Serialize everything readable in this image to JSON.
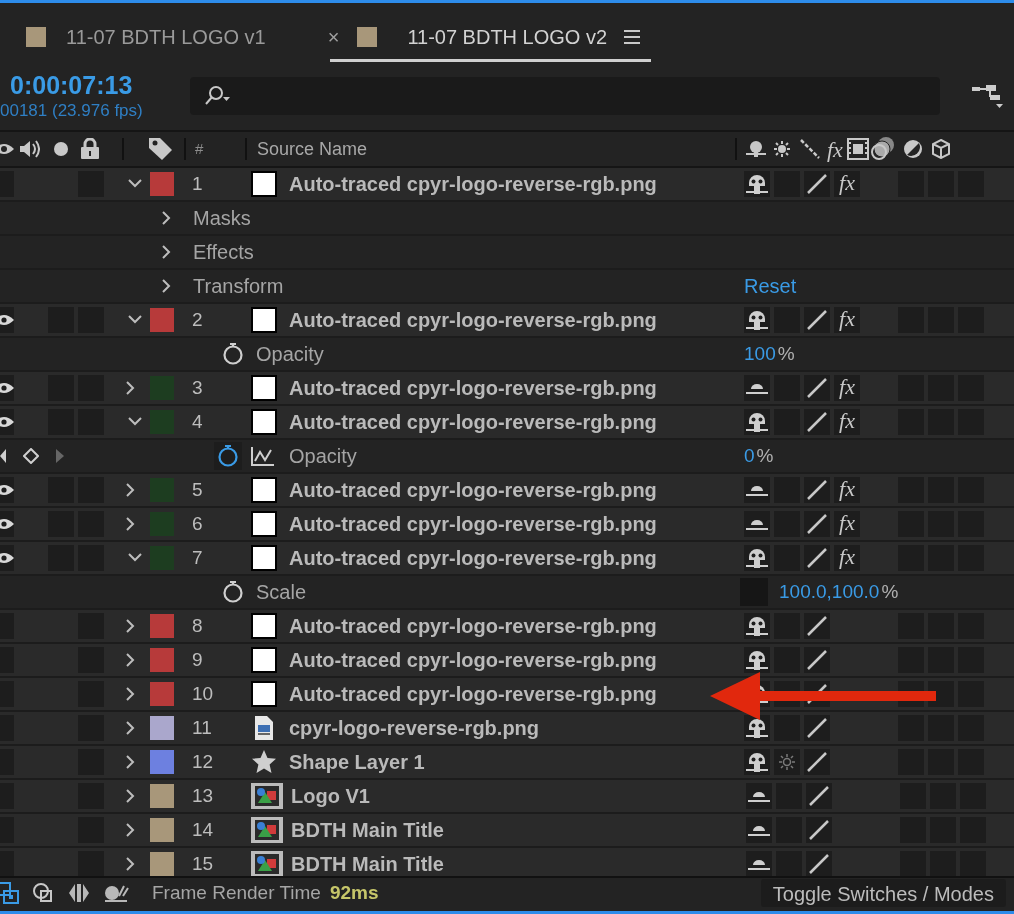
{
  "tabs": [
    {
      "label": "11-07 BDTH LOGO v1",
      "color": "#a8977a",
      "selected": false
    },
    {
      "label": "11-07 BDTH LOGO v2",
      "color": "#a8977a",
      "selected": true,
      "close": "×"
    }
  ],
  "timecode": "0:00:07:13",
  "frame_info": "00181 (23.976 fps)",
  "columns": {
    "number": "#",
    "source_name": "Source Name",
    "fx": "fx"
  },
  "layers": [
    {
      "number": "1",
      "name": "Auto-traced cpyr-logo-reverse-rgb.png",
      "color": "#b73a3a",
      "kind": "solid",
      "visible": false,
      "locked": false,
      "expanded": true,
      "shy": false,
      "collapse": false,
      "quality": true,
      "fx": "fx",
      "effects_on": true,
      "motion_blur": false,
      "adjustment": false,
      "three_d": false,
      "children": [
        {
          "kind": "group",
          "name": "Masks"
        },
        {
          "kind": "group",
          "name": "Effects"
        },
        {
          "kind": "group",
          "name": "Transform",
          "value": "Reset"
        }
      ]
    },
    {
      "number": "2",
      "name": "Auto-traced cpyr-logo-reverse-rgb.png",
      "color": "#b73a3a",
      "kind": "solid",
      "visible": true,
      "solo": false,
      "locked": false,
      "expanded": true,
      "shy": false,
      "collapse": false,
      "quality": true,
      "fx": "fx",
      "effects_on": true,
      "motion_blur": false,
      "adjustment": false,
      "three_d": false,
      "children": [
        {
          "kind": "property",
          "name": "Opacity",
          "value": "100",
          "unit": "%",
          "keyframed": false
        }
      ]
    },
    {
      "number": "3",
      "name": "Auto-traced cpyr-logo-reverse-rgb.png",
      "color": "#1d3d20",
      "kind": "solid",
      "visible": true,
      "solo": false,
      "locked": false,
      "expanded": false,
      "shy": true,
      "collapse": false,
      "quality": true,
      "fx": "fx",
      "effects_on": true,
      "motion_blur": false,
      "adjustment": false,
      "three_d": false
    },
    {
      "number": "4",
      "name": "Auto-traced cpyr-logo-reverse-rgb.png",
      "color": "#1d3d20",
      "kind": "solid",
      "visible": true,
      "solo": false,
      "locked": false,
      "expanded": true,
      "shy": false,
      "collapse": false,
      "quality": true,
      "fx": "fx",
      "effects_on": true,
      "motion_blur": false,
      "adjustment": false,
      "three_d": false,
      "children": [
        {
          "kind": "property",
          "name": "Opacity",
          "value": "0",
          "unit": "%",
          "keyframed": true
        }
      ]
    },
    {
      "number": "5",
      "name": "Auto-traced cpyr-logo-reverse-rgb.png",
      "color": "#1d3d20",
      "kind": "solid",
      "visible": true,
      "solo": false,
      "locked": false,
      "expanded": false,
      "shy": true,
      "collapse": false,
      "quality": true,
      "fx": "fx",
      "effects_on": true,
      "motion_blur": false,
      "adjustment": false,
      "three_d": false
    },
    {
      "number": "6",
      "name": "Auto-traced cpyr-logo-reverse-rgb.png",
      "color": "#1d3d20",
      "kind": "solid",
      "visible": true,
      "solo": false,
      "locked": false,
      "expanded": false,
      "shy": true,
      "collapse": false,
      "quality": true,
      "fx": "fx",
      "effects_on": true,
      "motion_blur": false,
      "adjustment": false,
      "three_d": false
    },
    {
      "number": "7",
      "name": "Auto-traced cpyr-logo-reverse-rgb.png",
      "color": "#1d3d20",
      "kind": "solid",
      "visible": true,
      "solo": false,
      "locked": false,
      "expanded": true,
      "shy": false,
      "collapse": false,
      "quality": true,
      "fx": "fx",
      "effects_on": true,
      "motion_blur": false,
      "adjustment": false,
      "three_d": false,
      "children": [
        {
          "kind": "property",
          "name": "Scale",
          "value": "100.0,100.0",
          "unit": "%",
          "keyframed": false,
          "constrain": false
        }
      ]
    },
    {
      "number": "8",
      "name": "Auto-traced cpyr-logo-reverse-rgb.png",
      "color": "#b73a3a",
      "kind": "solid",
      "visible": false,
      "locked": false,
      "expanded": false,
      "shy": false,
      "collapse": false,
      "quality": true,
      "motion_blur": false,
      "adjustment": false,
      "three_d": false
    },
    {
      "number": "9",
      "name": "Auto-traced cpyr-logo-reverse-rgb.png",
      "color": "#b73a3a",
      "kind": "solid",
      "visible": false,
      "locked": false,
      "expanded": false,
      "shy": false,
      "collapse": false,
      "quality": true,
      "motion_blur": false,
      "adjustment": false,
      "three_d": false
    },
    {
      "number": "10",
      "name": "Auto-traced cpyr-logo-reverse-rgb.png",
      "color": "#b73a3a",
      "kind": "solid",
      "visible": false,
      "locked": false,
      "expanded": false,
      "shy": false,
      "collapse": false,
      "quality": true,
      "motion_blur": false,
      "adjustment": false,
      "three_d": false
    },
    {
      "number": "11",
      "name": "cpyr-logo-reverse-rgb.png",
      "color": "#aaa7cc",
      "kind": "footage",
      "visible": false,
      "locked": false,
      "expanded": false,
      "shy": false,
      "collapse": false,
      "quality": true,
      "motion_blur": false,
      "adjustment": false,
      "three_d": false
    },
    {
      "number": "12",
      "name": "Shape Layer 1",
      "color": "#6d80e0",
      "kind": "shape",
      "visible": false,
      "locked": false,
      "expanded": false,
      "shy": false,
      "collapse": true,
      "quality": true,
      "motion_blur": false,
      "adjustment": false,
      "three_d": false
    },
    {
      "number": "13",
      "name": "Logo V1",
      "color": "#a8977a",
      "kind": "precomp",
      "visible": false,
      "locked": false,
      "expanded": false,
      "shy": true,
      "collapse": false,
      "quality": true,
      "motion_blur": false,
      "adjustment": false,
      "three_d": false
    },
    {
      "number": "14",
      "name": "BDTH Main Title",
      "color": "#a8977a",
      "kind": "precomp",
      "visible": false,
      "locked": false,
      "expanded": false,
      "shy": true,
      "collapse": false,
      "quality": true,
      "motion_blur": false,
      "adjustment": false,
      "three_d": false
    },
    {
      "number": "15",
      "name": "BDTH Main Title",
      "color": "#a8977a",
      "kind": "precomp",
      "visible": false,
      "locked": false,
      "expanded": false,
      "shy": true,
      "collapse": false,
      "quality": true,
      "motion_blur": false,
      "adjustment": false,
      "three_d": false
    }
  ],
  "status_bar": {
    "label": "Frame Render Time",
    "value": "92ms",
    "toggle_button": "Toggle Switches / Modes"
  }
}
